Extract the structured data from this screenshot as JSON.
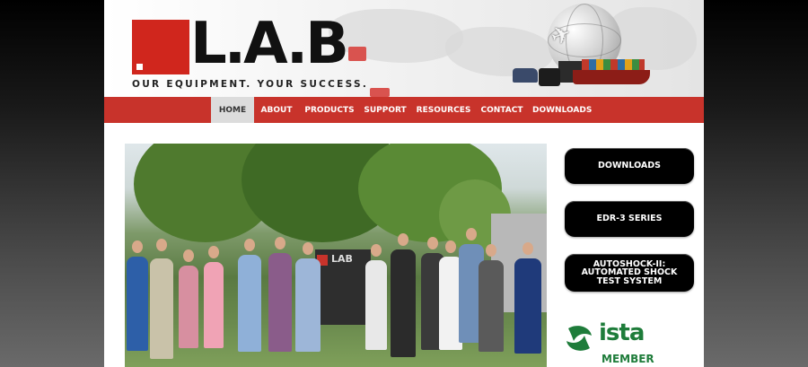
{
  "brand": {
    "logo_text": "L.A.B",
    "tagline": "OUR EQUIPMENT. YOUR SUCCESS."
  },
  "nav": {
    "items": [
      {
        "label": "HOME",
        "active": true
      },
      {
        "label": "ABOUT",
        "active": false
      },
      {
        "label": "PRODUCTS",
        "active": false
      },
      {
        "label": "SUPPORT",
        "active": false
      },
      {
        "label": "RESOURCES",
        "active": false
      },
      {
        "label": "CONTACT",
        "active": false
      },
      {
        "label": "DOWNLOADS",
        "active": false
      }
    ]
  },
  "sidebar": {
    "buttons": [
      {
        "label": "DOWNLOADS"
      },
      {
        "label": "EDR-3 SERIES"
      },
      {
        "label": "AUTOSHOCK-II: AUTOMATED SHOCK TEST SYSTEM"
      }
    ],
    "badge": {
      "name": "ista",
      "sub": "MEMBER"
    }
  },
  "hero": {
    "sign_text": "LAB"
  },
  "colors": {
    "brand_red": "#c8332b",
    "ista_green": "#1e7c3a",
    "button_black": "#000000"
  },
  "icons": [
    "globe-icon",
    "plane-icon",
    "truck-icon",
    "ship-icon",
    "ista-logo-icon"
  ]
}
